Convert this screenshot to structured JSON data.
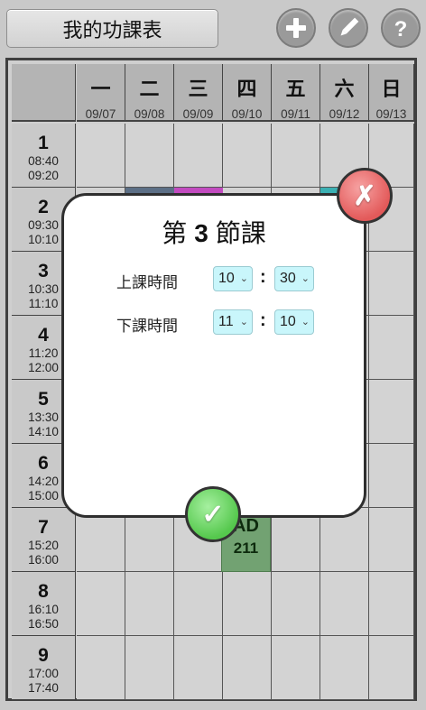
{
  "app": {
    "title": "我的功課表"
  },
  "toolbar": {
    "add_icon": "plus-icon",
    "edit_icon": "pencil-icon",
    "help_icon": "question-icon"
  },
  "days": [
    {
      "name": "一",
      "date": "09/07"
    },
    {
      "name": "二",
      "date": "09/08"
    },
    {
      "name": "三",
      "date": "09/09"
    },
    {
      "name": "四",
      "date": "09/10"
    },
    {
      "name": "五",
      "date": "09/11"
    },
    {
      "name": "六",
      "date": "09/12"
    },
    {
      "name": "日",
      "date": "09/13"
    }
  ],
  "periods": [
    {
      "num": "1",
      "start": "08:40",
      "end": "09:20"
    },
    {
      "num": "2",
      "start": "09:30",
      "end": "10:10"
    },
    {
      "num": "3",
      "start": "10:30",
      "end": "11:10"
    },
    {
      "num": "4",
      "start": "11:20",
      "end": "12:00"
    },
    {
      "num": "5",
      "start": "13:30",
      "end": "14:10"
    },
    {
      "num": "6",
      "start": "14:20",
      "end": "15:00"
    },
    {
      "num": "7",
      "start": "15:20",
      "end": "16:00"
    },
    {
      "num": "8",
      "start": "16:10",
      "end": "16:50"
    },
    {
      "num": "9",
      "start": "17:00",
      "end": "17:40"
    }
  ],
  "visible_course": {
    "name": "AD",
    "room": "211",
    "color": "#72a272"
  },
  "peek_colors": {
    "tuesday": "#5c6f86",
    "wednesday": "#c24bc0",
    "saturday": "#3bb0b3"
  },
  "dialog": {
    "title_prefix": "第",
    "period_number": "3",
    "title_suffix": "節課",
    "start_label": "上課時間",
    "end_label": "下課時間",
    "start_hour": "10",
    "start_minute": "30",
    "end_hour": "11",
    "end_minute": "10",
    "separator": ":",
    "close_glyph": "✗",
    "confirm_glyph": "✓"
  }
}
